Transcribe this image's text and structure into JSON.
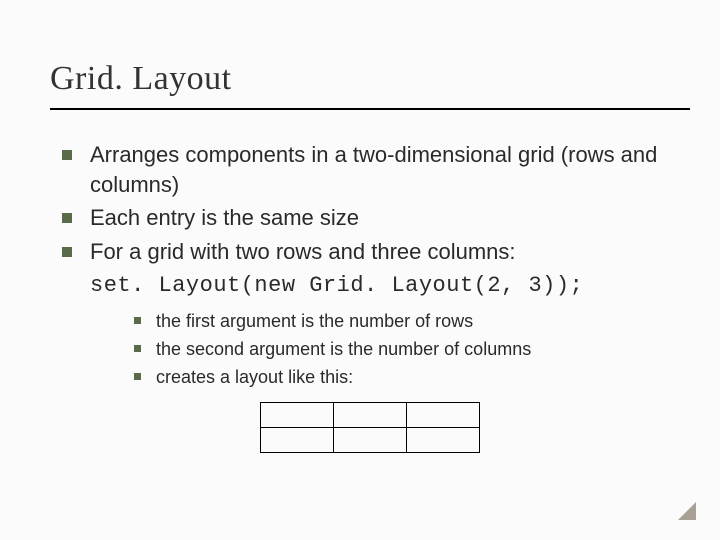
{
  "title": "Grid. Layout",
  "bullets": {
    "b1": "Arranges components in a two-dimensional grid (rows and columns)",
    "b2": "Each entry is the same size",
    "b3": "For a grid with two rows and three columns:"
  },
  "code": "set. Layout(new Grid. Layout(2, 3));",
  "sub": {
    "s1": "the first argument is the number of rows",
    "s2": "the second argument is the number of columns",
    "s3": "creates a layout like this:"
  },
  "grid": {
    "rows": 2,
    "cols": 3
  }
}
